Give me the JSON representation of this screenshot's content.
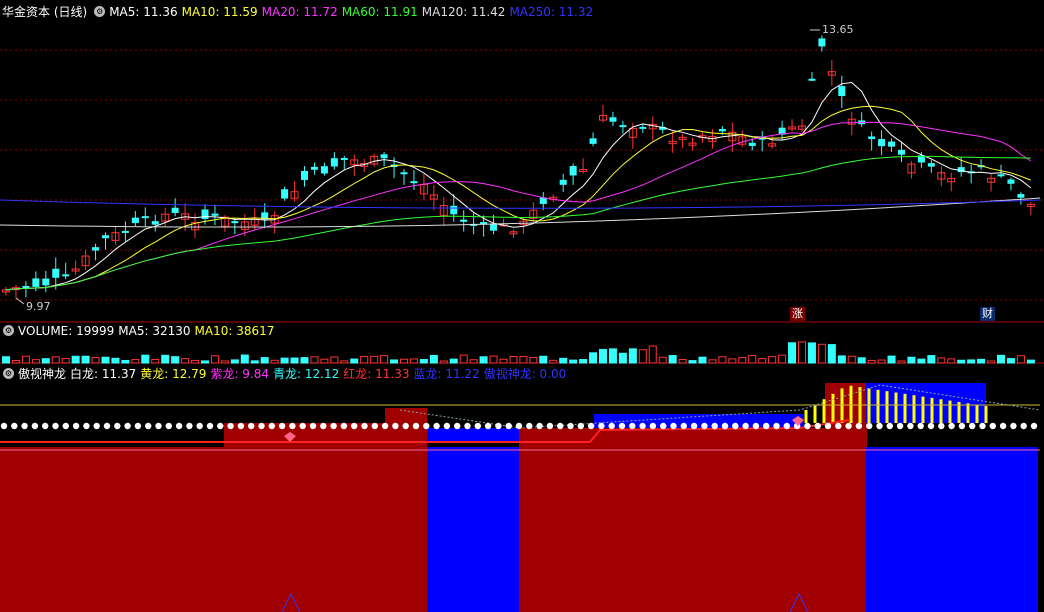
{
  "price_panel": {
    "title": "华金资本 (日线)",
    "indicators": [
      {
        "label": "MA5: 11.36",
        "color": "#ffffff"
      },
      {
        "label": "MA10: 11.59",
        "color": "#ffff33"
      },
      {
        "label": "MA20: 11.72",
        "color": "#ff33ff"
      },
      {
        "label": "MA60: 11.91",
        "color": "#33ff33"
      },
      {
        "label": "MA120: 11.42",
        "color": "#dddddd"
      },
      {
        "label": "MA250: 11.32",
        "color": "#3333ff"
      }
    ],
    "high_label": "13.65",
    "low_label": "9.97",
    "event_tag_up": "涨",
    "event_tag_fin": "财"
  },
  "volume_panel": {
    "indicators": [
      {
        "label": "VOLUME: 19999",
        "color": "#ffffff"
      },
      {
        "label": "MA5: 32130",
        "color": "#ffffff"
      },
      {
        "label": "MA10: 38617",
        "color": "#ffff33"
      }
    ]
  },
  "indicator_panel": {
    "indicators": [
      {
        "label": "傲视神龙",
        "color": "#ffffff"
      },
      {
        "label": "白龙: 11.37",
        "color": "#ffffff"
      },
      {
        "label": "黄龙: 12.79",
        "color": "#ffff33"
      },
      {
        "label": "紫龙: 9.84",
        "color": "#ff33ff"
      },
      {
        "label": "青龙: 12.12",
        "color": "#33ffff"
      },
      {
        "label": "红龙: 11.33",
        "color": "#ff3333"
      },
      {
        "label": "蓝龙: 11.22",
        "color": "#3333ff"
      },
      {
        "label": "傲视神龙: 0.00",
        "color": "#3333ff"
      }
    ],
    "zones": [
      "red",
      "blue",
      "red",
      "blue"
    ]
  },
  "colors": {
    "up": "#ff3333",
    "down": "#33ffff",
    "zone_red": "#a00000",
    "zone_blue": "#0000ff",
    "grid": "#8b0000"
  }
}
